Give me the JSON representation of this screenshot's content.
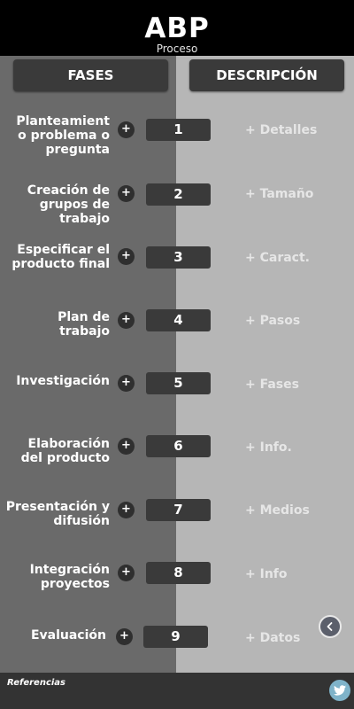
{
  "header": {
    "title": "ABP",
    "subtitle": "Proceso"
  },
  "columns": {
    "left": "FASES",
    "right": "DESCRIPCIÓN"
  },
  "rows": [
    {
      "phase": "Planteamient o problema o pregunta",
      "plus": "+",
      "number": "1",
      "detail": "+ Detalles"
    },
    {
      "phase": "Creación de grupos de trabajo",
      "plus": "+",
      "number": "2",
      "detail": "+ Tamaño"
    },
    {
      "phase": "Especificar el producto final",
      "plus": "+",
      "number": "3",
      "detail": "+ Caract."
    },
    {
      "phase": "Plan de trabajo",
      "plus": "+",
      "number": "4",
      "detail": "+ Pasos"
    },
    {
      "phase": "Investigación",
      "plus": "+",
      "number": "5",
      "detail": "+ Fases"
    },
    {
      "phase": "Elaboración del producto",
      "plus": "+",
      "number": "6",
      "detail": "+ Info."
    },
    {
      "phase": "Presentación y difusión",
      "plus": "+",
      "number": "7",
      "detail": "+ Medios"
    },
    {
      "phase": "Integración proyectos",
      "plus": "+",
      "number": "8",
      "detail": "+ Info"
    },
    {
      "phase": "Evaluación",
      "plus": "+",
      "number": "9",
      "detail": "+ Datos"
    }
  ],
  "footer": {
    "references": "Referencias"
  },
  "icons": {
    "back": "chevron-left-icon",
    "social": "twitter-icon"
  },
  "colors": {
    "left_panel": "#6a6a6a",
    "right_panel": "#b6b6b6",
    "buttons": "#3a3a3a",
    "twitter": "#7fb3c9"
  }
}
